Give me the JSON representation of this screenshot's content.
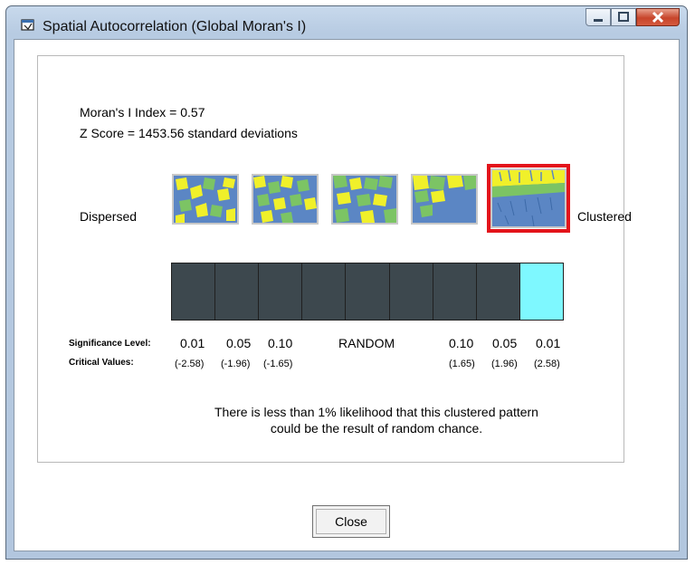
{
  "window": {
    "title": "Spatial Autocorrelation (Global Moran's I)",
    "caption_buttons": [
      "minimize-icon",
      "maximize-icon",
      "close-icon"
    ]
  },
  "results": {
    "morans_label": "Moran's I Index = 0.57",
    "zscore_label": "Z Score = 1453.56 standard deviations"
  },
  "pattern_scale": {
    "left_label": "Dispersed",
    "right_label": "Clustered",
    "thumbnails": [
      "dispersed-pattern",
      "slightly-dispersed-pattern",
      "random-pattern",
      "slightly-clustered-pattern",
      "clustered-pattern"
    ],
    "selected_index": 4
  },
  "significance_bar": {
    "segments": 9,
    "highlighted_segment": 8,
    "colors": {
      "segment": "#3d484e",
      "highlight": "#7ef8ff",
      "selection_border": "#e3141b"
    }
  },
  "legend": {
    "significance_label": "Significance Level:",
    "critical_label": "Critical Values:",
    "levels": [
      "0.01",
      "0.05",
      "0.10",
      "RANDOM",
      "0.10",
      "0.05",
      "0.01"
    ],
    "critical_values": [
      "(-2.58)",
      "(-1.96)",
      "(-1.65)",
      "(1.65)",
      "(1.96)",
      "(2.58)"
    ]
  },
  "message": {
    "line1": "There is less than 1% likelihood that this clustered pattern",
    "line2": "could be the result of random chance."
  },
  "close_button": {
    "label": "Close"
  }
}
